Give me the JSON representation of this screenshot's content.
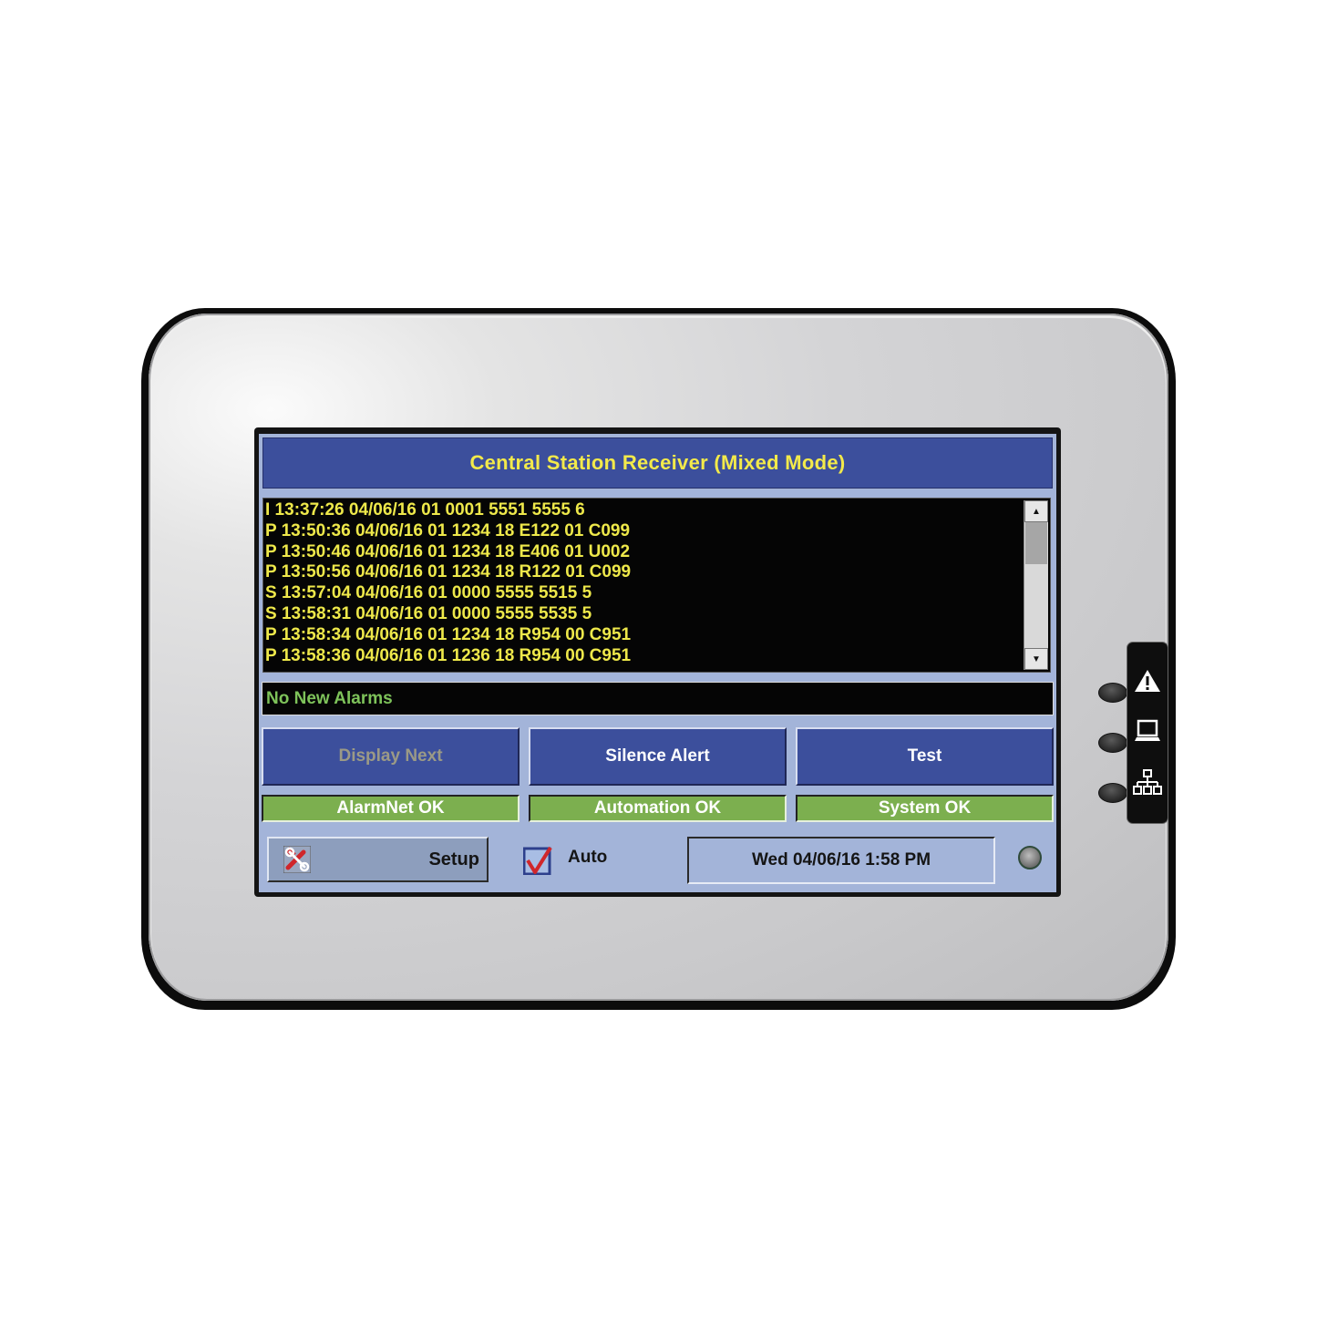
{
  "header": {
    "title": "Central Station Receiver (Mixed Mode)"
  },
  "log": {
    "lines": [
      "I 13:37:26 04/06/16 01 0001 5551 5555 6",
      "P 13:50:36 04/06/16 01 1234 18 E122 01 C099",
      "P 13:50:46 04/06/16 01 1234 18 E406 01 U002",
      "P 13:50:56 04/06/16 01 1234 18 R122 01 C099",
      "S 13:57:04 04/06/16 01 0000 5555 5515 5",
      "S 13:58:31 04/06/16 01 0000 5555 5535 5",
      "P 13:58:34 04/06/16 01 1234 18 R954 00 C951",
      "P 13:58:36 04/06/16 01 1236 18 R954 00 C951"
    ],
    "scroll_up_icon": "triangle-up",
    "scroll_down_icon": "triangle-down"
  },
  "alarm_status": "No New Alarms",
  "buttons": {
    "display_next": "Display Next",
    "silence_alert": "Silence Alert",
    "test": "Test"
  },
  "status_indicators": {
    "alarmnet": "AlarmNet OK",
    "automation": "Automation OK",
    "system": "System OK"
  },
  "bottom": {
    "setup_label": "Setup",
    "setup_icon": "tools-icon",
    "auto_label": "Auto",
    "auto_checked": true,
    "datetime": "Wed 04/06/16  1:58 PM"
  },
  "side_panel": {
    "icons": [
      "warning-icon",
      "computer-icon",
      "network-icon"
    ]
  },
  "colors": {
    "title_bg": "#3c4f9c",
    "title_text": "#f3ea4a",
    "log_text": "#eee84a",
    "alarm_text": "#7ec35a",
    "status_ok": "#7caf4f",
    "screen_bg": "#a3b4d9"
  }
}
